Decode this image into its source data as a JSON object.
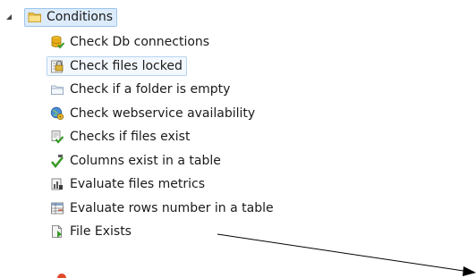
{
  "tree": {
    "root": {
      "label": "Conditions",
      "icon": "folder-icon",
      "expanded": true
    },
    "children": [
      {
        "label": "Check Db connections",
        "icon": "database-check-icon"
      },
      {
        "label": "Check files locked",
        "icon": "file-lock-icon",
        "hovered": true
      },
      {
        "label": "Check if a folder is empty",
        "icon": "empty-folder-icon"
      },
      {
        "label": "Check webservice availability",
        "icon": "webservice-icon"
      },
      {
        "label": "Checks if files exist",
        "icon": "files-check-icon"
      },
      {
        "label": "Columns exist in a table",
        "icon": "checkmark-icon"
      },
      {
        "label": "Evaluate files metrics",
        "icon": "file-metrics-icon"
      },
      {
        "label": "Evaluate rows number in a table",
        "icon": "table-rows-icon"
      },
      {
        "label": "File Exists",
        "icon": "file-exists-icon"
      }
    ]
  },
  "colors": {
    "selection_bg": "#dcebfb",
    "selection_border": "#9ec5ec",
    "hover_border": "#b7d4f1",
    "arrow": "#000000"
  }
}
